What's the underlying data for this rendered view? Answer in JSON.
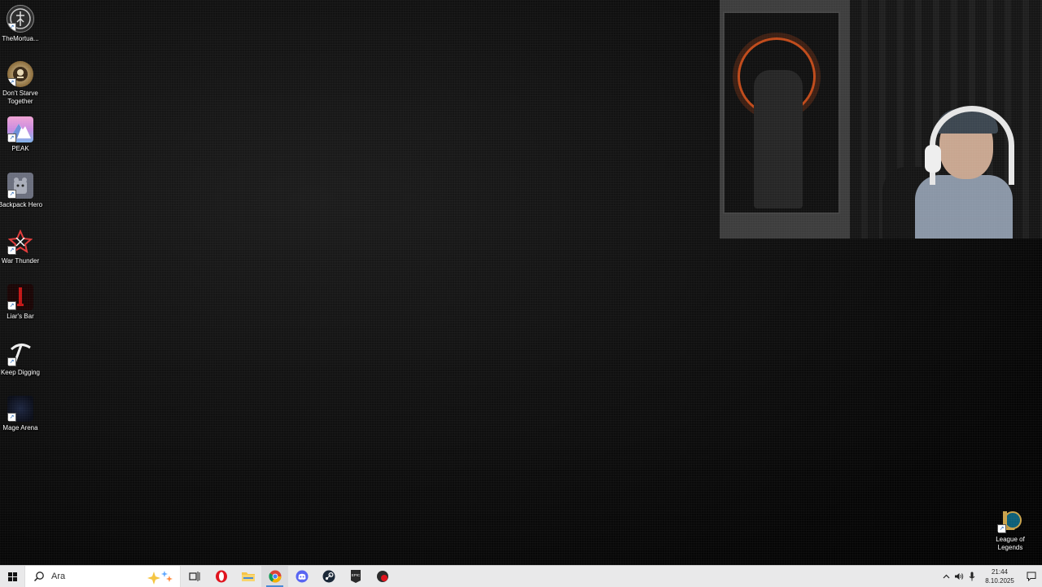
{
  "desktop": {
    "icons": [
      {
        "label": "TheMortua...",
        "icon": "mortuary-game-icon"
      },
      {
        "label": "Don't Starve Together",
        "icon": "dont-starve-icon"
      },
      {
        "label": "PEAK",
        "icon": "peak-icon"
      },
      {
        "label": "Backpack Hero",
        "icon": "backpack-hero-icon"
      },
      {
        "label": "War Thunder",
        "icon": "war-thunder-icon"
      },
      {
        "label": "Liar's Bar",
        "icon": "liars-bar-icon"
      },
      {
        "label": "Keep Digging",
        "icon": "keep-digging-icon"
      },
      {
        "label": "Mage Arena",
        "icon": "mage-arena-icon"
      }
    ],
    "corner_icon": {
      "label": "League of Legends",
      "icon": "league-of-legends-icon"
    }
  },
  "taskbar": {
    "search_text": "Ara",
    "pinned": [
      {
        "name": "task-view",
        "icon": "task-view-icon"
      },
      {
        "name": "opera",
        "icon": "opera-icon"
      },
      {
        "name": "file-explorer",
        "icon": "folder-icon"
      },
      {
        "name": "chrome",
        "icon": "chrome-icon"
      },
      {
        "name": "discord",
        "icon": "discord-icon"
      },
      {
        "name": "steam",
        "icon": "steam-icon"
      },
      {
        "name": "epic-games",
        "icon": "epic-games-icon"
      },
      {
        "name": "streaming-app",
        "icon": "red-record-icon"
      }
    ],
    "clock": {
      "time": "21:44",
      "date": "8.10.2025"
    }
  },
  "colors": {
    "taskbar_bg": "#e9e9ea",
    "accent": "#4a8bd6"
  }
}
